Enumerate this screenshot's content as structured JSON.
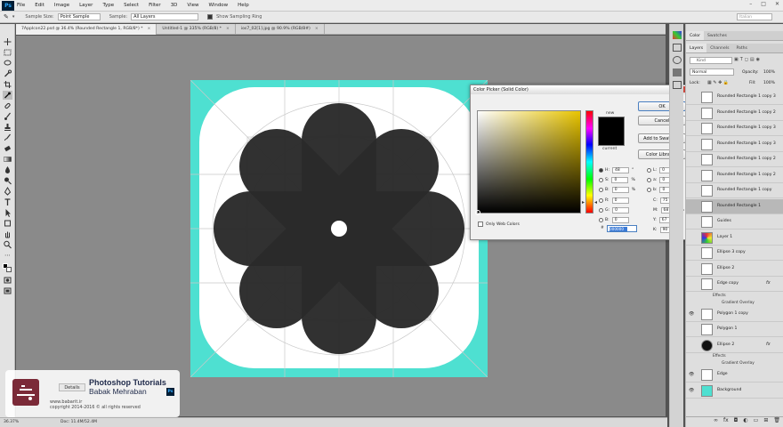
{
  "app": {
    "logo": "Ps"
  },
  "menu": [
    "File",
    "Edit",
    "Image",
    "Layer",
    "Type",
    "Select",
    "Filter",
    "3D",
    "View",
    "Window",
    "Help"
  ],
  "options_bar": {
    "sample_size_label": "Sample Size:",
    "sample_size_value": "Point Sample",
    "sample_label": "Sample:",
    "sample_value": "All Layers",
    "sampling_ring_label": "Show Sampling Ring",
    "workspace_search": "Italian"
  },
  "tabs": [
    {
      "label": "7AppIcon22.psd @ 36.4% (Rounded Rectangle 1, RGB/8*) *",
      "active": true
    },
    {
      "label": "Untitled-1 @ 335% (RGB/8) *",
      "active": false
    },
    {
      "label": "ios7_02[1].jpg @ 90.9% (RGB/8#)",
      "active": false
    }
  ],
  "status": {
    "zoom": "36.37%",
    "doc": "Doc: 11.4M/52.4M"
  },
  "colors": {
    "canvas_bg": "#4ee0d1",
    "icon_bg": "#ffffff",
    "flower": "#2b2b2b",
    "accent": "#3b7ad6"
  },
  "color_picker": {
    "title": "Color Picker (Solid Color)",
    "close": "x",
    "new_label": "new",
    "current_label": "current",
    "buttons": {
      "ok": "OK",
      "cancel": "Cancel",
      "add_swatches": "Add to Swatches",
      "color_libraries": "Color Libraries"
    },
    "only_web_colors": "Only Web Colors",
    "fields": {
      "H": {
        "value": "48",
        "unit": "°"
      },
      "S": {
        "value": "0",
        "unit": "%"
      },
      "B": {
        "value": "0",
        "unit": "%"
      },
      "R": {
        "value": "0",
        "unit": ""
      },
      "G": {
        "value": "0",
        "unit": ""
      },
      "Bv": {
        "value": "0",
        "unit": ""
      },
      "L": {
        "value": "0",
        "unit": ""
      },
      "a": {
        "value": "0",
        "unit": ""
      },
      "b": {
        "value": "0",
        "unit": ""
      },
      "C": {
        "value": "75",
        "unit": "%"
      },
      "M": {
        "value": "68",
        "unit": "%"
      },
      "Y": {
        "value": "67",
        "unit": "%"
      },
      "K": {
        "value": "90",
        "unit": "%"
      }
    },
    "hex": "000000"
  },
  "panel_tabs_top": [
    "Color",
    "Swatches"
  ],
  "panel_tabs": [
    "Layers",
    "Channels",
    "Paths"
  ],
  "layers_panel": {
    "filter_label": "Kind",
    "blend_mode": "Normal",
    "opacity_label": "Opacity:",
    "opacity": "100%",
    "lock_label": "Lock:",
    "fill_label": "Fill:",
    "fill": "100%"
  },
  "layers": [
    {
      "name": "Rounded Rectangle 1 copy 3",
      "visible": false,
      "selected": false
    },
    {
      "name": "Rounded Rectangle 1 copy 2",
      "visible": false,
      "selected": false
    },
    {
      "name": "Rounded Rectangle 1 copy 3",
      "visible": false,
      "selected": false
    },
    {
      "name": "Rounded Rectangle 1 copy 3",
      "visible": false,
      "selected": false
    },
    {
      "name": "Rounded Rectangle 1 copy 2",
      "visible": false,
      "selected": false
    },
    {
      "name": "Rounded Rectangle 1 copy 2",
      "visible": false,
      "selected": false
    },
    {
      "name": "Rounded Rectangle 1 copy",
      "visible": false,
      "selected": false
    },
    {
      "name": "Rounded Rectangle 1",
      "visible": false,
      "selected": true
    },
    {
      "name": "Guides",
      "visible": false,
      "selected": false
    },
    {
      "name": "Layer 1",
      "visible": false,
      "selected": false
    },
    {
      "name": "Ellipse 3 copy",
      "visible": false,
      "selected": false
    },
    {
      "name": "Ellipse 2",
      "visible": false,
      "selected": false
    },
    {
      "name": "Edge copy",
      "visible": false,
      "selected": false,
      "fx": "fx",
      "effects": [
        "Effects",
        "Gradient Overlay"
      ]
    },
    {
      "name": "Polygon 1 copy",
      "visible": true,
      "selected": false
    },
    {
      "name": "Polygon 1",
      "visible": false,
      "selected": false
    },
    {
      "name": "Ellipse 2",
      "visible": false,
      "selected": false,
      "fx": "fx",
      "effects": [
        "Effects",
        "Gradient Overlay"
      ]
    },
    {
      "name": "Edge",
      "visible": true,
      "selected": false
    },
    {
      "name": "Background",
      "visible": true,
      "selected": false
    }
  ],
  "watermark": {
    "details": "Details",
    "title": "Photoshop Tutorials",
    "author": "Babak Mehraban",
    "site": "www.babarit.ir",
    "copyright": "copyright 2014-2016 © all rights reserved"
  }
}
